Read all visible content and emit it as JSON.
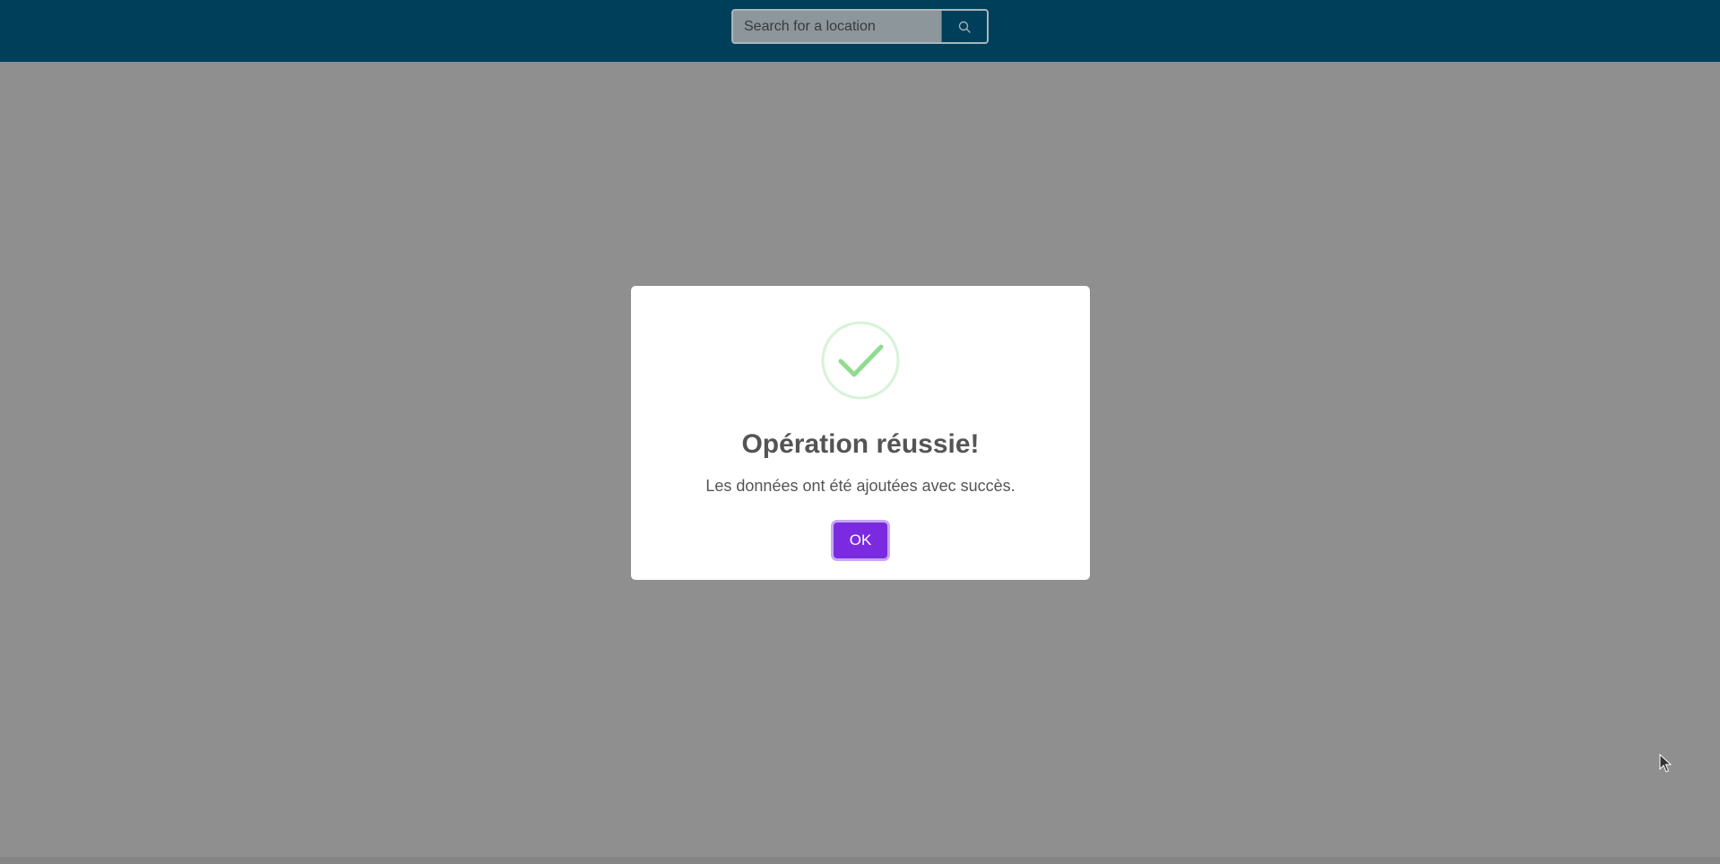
{
  "header": {
    "search": {
      "placeholder": "Search for a location",
      "value": ""
    },
    "search_button_icon": "search-icon",
    "background": "#003f5a"
  },
  "modal": {
    "icon": "success-check-icon",
    "title": "Opération réussie!",
    "text": "Les données ont été ajoutées avec succès.",
    "ok_label": "OK",
    "accent": "#7a2be0",
    "success_color": "#8fdc8f"
  },
  "overlay": {
    "color": "#8f8f8f"
  }
}
